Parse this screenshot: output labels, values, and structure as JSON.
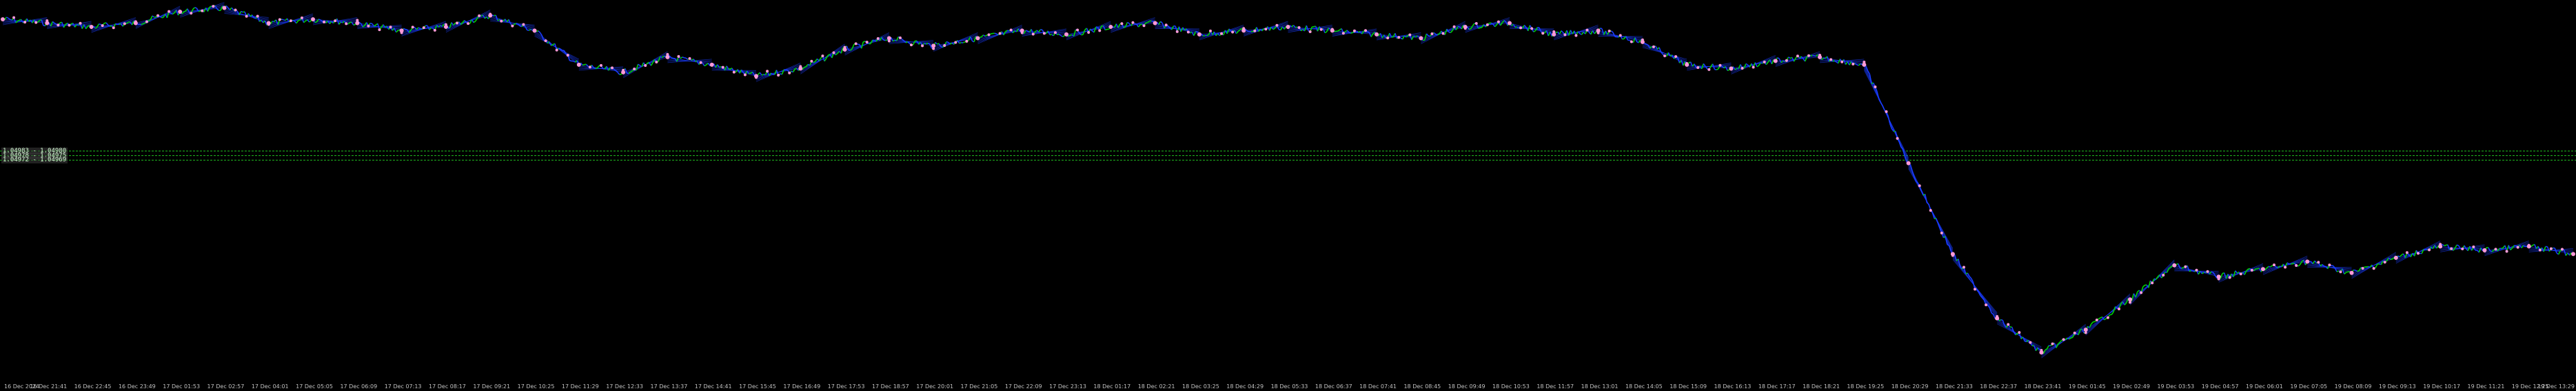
{
  "chart_data": {
    "type": "line",
    "title": "",
    "xlabel": "",
    "ylabel": "",
    "grid": false,
    "colors": {
      "background": "#000000",
      "price_up": "#00d400",
      "price_down": "#1a3cff",
      "marker": "#ff9ad8",
      "level_line": "#20c020",
      "axis_text": "#c0c0c0"
    },
    "ylim": [
      0,
      100
    ],
    "x_tick_labels": [
      "16 Dec 2024",
      "16 Dec 21:41",
      "16 Dec 22:45",
      "16 Dec 23:49",
      "17 Dec 01:53",
      "17 Dec 02:57",
      "17 Dec 04:01",
      "17 Dec 05:05",
      "17 Dec 06:09",
      "17 Dec 07:13",
      "17 Dec 08:17",
      "17 Dec 09:21",
      "17 Dec 10:25",
      "17 Dec 11:29",
      "17 Dec 12:33",
      "17 Dec 13:37",
      "17 Dec 14:41",
      "17 Dec 15:45",
      "17 Dec 16:49",
      "17 Dec 17:53",
      "17 Dec 18:57",
      "17 Dec 20:01",
      "17 Dec 21:05",
      "17 Dec 22:09",
      "17 Dec 23:13",
      "18 Dec 01:17",
      "18 Dec 02:21",
      "18 Dec 03:25",
      "18 Dec 04:29",
      "18 Dec 05:33",
      "18 Dec 06:37",
      "18 Dec 07:41",
      "18 Dec 08:45",
      "18 Dec 09:49",
      "18 Dec 10:53",
      "18 Dec 11:57",
      "18 Dec 13:01",
      "18 Dec 14:05",
      "18 Dec 15:09",
      "18 Dec 16:13",
      "18 Dec 17:17",
      "18 Dec 18:21",
      "18 Dec 19:25",
      "18 Dec 20:29",
      "18 Dec 21:33",
      "18 Dec 22:37",
      "18 Dec 23:41",
      "19 Dec 01:45",
      "19 Dec 02:49",
      "19 Dec 03:53",
      "19 Dec 04:57",
      "19 Dec 06:01",
      "19 Dec 07:05",
      "19 Dec 08:09",
      "19 Dec 09:13",
      "19 Dec 10:17",
      "19 Dec 11:21",
      "19 Dec 12:25",
      "19 Dec 13:29"
    ],
    "series": [
      {
        "x_index": [
          0,
          1,
          2,
          3,
          4,
          5,
          6,
          7,
          8,
          9,
          10,
          11,
          12,
          13,
          14,
          15,
          16,
          17,
          18,
          19,
          20,
          21,
          22,
          23,
          24,
          25,
          26,
          27,
          28,
          29,
          30,
          31,
          32,
          33,
          34,
          35,
          36,
          37,
          38,
          39,
          40,
          41,
          42,
          43,
          44,
          45,
          46,
          47,
          48,
          49,
          50,
          51,
          52,
          53,
          54,
          55,
          56,
          57,
          58
        ],
        "values": [
          96,
          95,
          94,
          95,
          98,
          99,
          95,
          96,
          95,
          93,
          94,
          97,
          93,
          84,
          82,
          86,
          84,
          81,
          83,
          88,
          91,
          89,
          91,
          93,
          92,
          94,
          95,
          92,
          93,
          94,
          93,
          92,
          91,
          94,
          95,
          92,
          93,
          90,
          84,
          83,
          85,
          86,
          84,
          58,
          34,
          17,
          8,
          14,
          22,
          31,
          28,
          30,
          32,
          29,
          33,
          36,
          35,
          36,
          34
        ]
      }
    ],
    "levels": [
      {
        "label": "1.04983 - 1.04980",
        "value": 61.2
      },
      {
        "label": "1.04978 - 1.04975",
        "value": 60.0
      },
      {
        "label": "1.04972 - 1.04969",
        "value": 58.8
      }
    ]
  }
}
